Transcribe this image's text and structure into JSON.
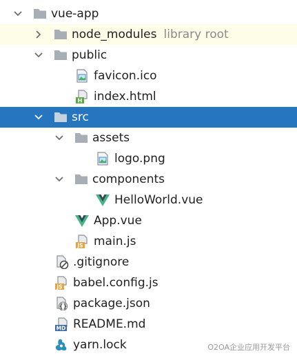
{
  "tree": {
    "root": {
      "name": "vue-app",
      "icon": "folder-icon",
      "expanded": true
    },
    "node_modules": {
      "name": "node_modules",
      "hint": "library root",
      "icon": "folder-icon",
      "expanded": false
    },
    "public": {
      "name": "public",
      "icon": "folder-icon",
      "expanded": true
    },
    "favicon": {
      "name": "favicon.ico",
      "icon": "image-file-icon"
    },
    "index_html": {
      "name": "index.html",
      "icon": "html-file-icon",
      "badge": "H"
    },
    "src": {
      "name": "src",
      "icon": "folder-icon",
      "expanded": true,
      "selected": true
    },
    "assets": {
      "name": "assets",
      "icon": "folder-icon",
      "expanded": true
    },
    "logo": {
      "name": "logo.png",
      "icon": "image-file-icon"
    },
    "components": {
      "name": "components",
      "icon": "folder-icon",
      "expanded": true
    },
    "helloworld": {
      "name": "HelloWorld.vue",
      "icon": "vue-icon"
    },
    "app_vue": {
      "name": "App.vue",
      "icon": "vue-icon"
    },
    "main_js": {
      "name": "main.js",
      "icon": "js-file-icon",
      "badge": "JS"
    },
    "gitignore": {
      "name": ".gitignore",
      "icon": "ignore-file-icon"
    },
    "babel": {
      "name": "babel.config.js",
      "icon": "js-file-icon",
      "badge": "JS"
    },
    "package": {
      "name": "package.json",
      "icon": "json-file-icon",
      "badge": "{}"
    },
    "readme": {
      "name": "README.md",
      "icon": "markdown-file-icon",
      "badge": "MD"
    },
    "yarn": {
      "name": "yarn.lock",
      "icon": "yarn-icon"
    }
  },
  "watermark": "O2OA企业应用开发平台",
  "colors": {
    "selection": "#2675bf",
    "library_bg": "#fefde8",
    "folder": "#a7aeb6",
    "vue_green": "#41b883",
    "vue_dark": "#35495e",
    "js_badge": "#e8a33d",
    "html_badge": "#5ea84a",
    "md_badge": "#3b6aa3",
    "hint": "#8a8a8a"
  }
}
